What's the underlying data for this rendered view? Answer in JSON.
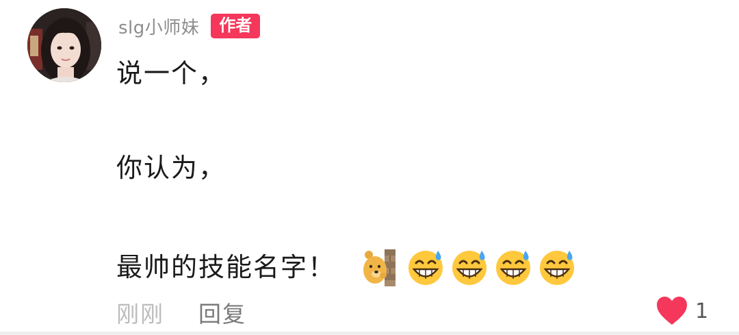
{
  "comment": {
    "username": "slg小师妹",
    "author_badge": "作者",
    "lines": [
      "说一个，",
      "你认为，",
      "最帅的技能名字！"
    ],
    "emojis": [
      "bear-peeking-wall-icon",
      "sweat-grin-emoji-icon",
      "sweat-grin-emoji-icon",
      "sweat-grin-emoji-icon",
      "sweat-grin-emoji-icon"
    ],
    "time": "刚刚",
    "reply_label": "回复",
    "like_count": "1",
    "colors": {
      "badge": "#f4375b",
      "heart": "#f4375b",
      "username": "#8d8d8d",
      "text": "#1a1a1a"
    }
  }
}
